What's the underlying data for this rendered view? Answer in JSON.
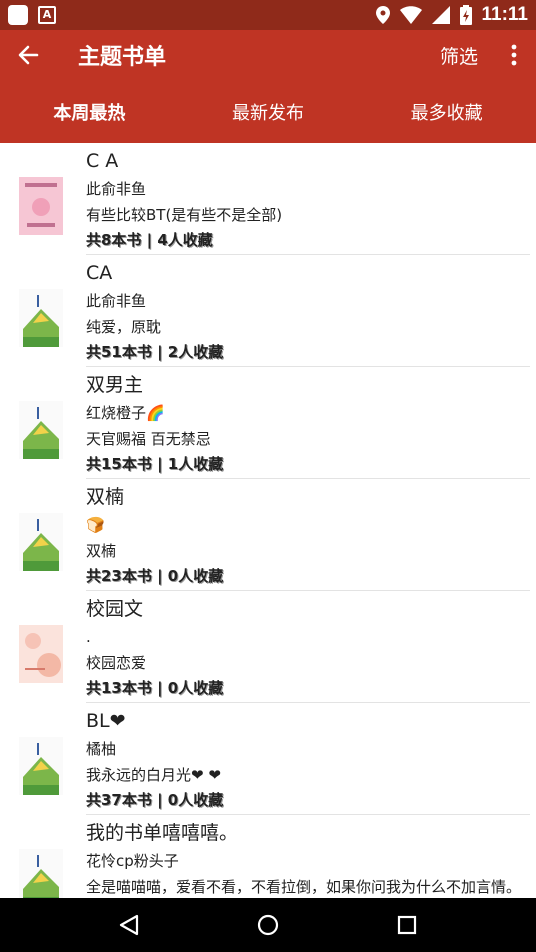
{
  "status_bar": {
    "time": "11:11",
    "icons": [
      "app-icon",
      "app-a-icon",
      "location-icon",
      "wifi-icon",
      "signal-icon",
      "battery-icon"
    ]
  },
  "app_bar": {
    "title": "主题书单",
    "filter_label": "筛选",
    "icons": [
      "back-arrow-icon",
      "more-vert-icon"
    ]
  },
  "tabs": [
    {
      "label": "本周最热",
      "active": true
    },
    {
      "label": "最新发布",
      "active": false
    },
    {
      "label": "最多收藏",
      "active": false
    }
  ],
  "booklists": [
    {
      "title": "C A",
      "author": "此俞非鱼",
      "desc": "有些比较BT(是有些不是全部)",
      "stats": "共8本书 | 4人收藏"
    },
    {
      "title": "CA",
      "author": "此俞非鱼",
      "desc": "纯爱，原耽",
      "stats": "共51本书 | 2人收藏"
    },
    {
      "title": "双男主",
      "author": "红烧橙子🌈",
      "desc": "天官赐福 百无禁忌",
      "stats": "共15本书 | 1人收藏"
    },
    {
      "title": "双楠",
      "author": "🍞",
      "desc": "双楠",
      "stats": "共23本书 | 0人收藏"
    },
    {
      "title": "校园文",
      "author": ".",
      "desc": "校园恋爱",
      "stats": "共13本书 | 0人收藏"
    },
    {
      "title": "BL❤",
      "author": "橘柚",
      "desc": "我永远的白月光❤ ❤",
      "stats": "共37本书 | 0人收藏"
    },
    {
      "title": "我的书单嘻嘻嘻。",
      "author": "花怜cp粉头子",
      "desc": "全是喵喵喵，爱看不看，不看拉倒，如果你问我为什么不加言情。",
      "stats": ""
    }
  ],
  "colors": {
    "status_bar": "#8f2a1a",
    "app_bar": "#bf3424",
    "nav_bar": "#000000"
  },
  "nav_bar": {
    "icons": [
      "back-triangle-icon",
      "home-circle-icon",
      "recents-square-icon"
    ]
  }
}
